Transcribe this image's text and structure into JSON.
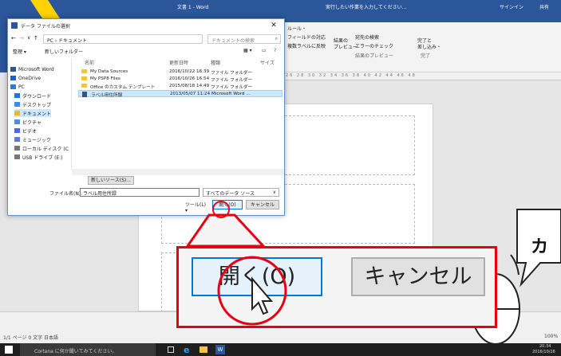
{
  "word": {
    "doc_title": "文書 1 - Word",
    "tell_me": "実行したい作業を入力してください...",
    "signin": "サインイン",
    "share": "共有",
    "ribbon_items": [
      "ルール・",
      "フィールドの対応",
      "複数ラベルに反映",
      "結果の",
      "プレビュー",
      "宛先の検索",
      "エラーのチェック",
      "結果のプレビュー",
      "完了と",
      "差し込み・",
      "完了"
    ],
    "ruler_numbers": "24 26 28 30 32 34 36 38 40 42 44 46 48",
    "status": "1/1 ページ  0 文字  日本語",
    "zoom": "100%"
  },
  "taskbar": {
    "cortana": "Cortana に何か聞いてみてください。",
    "time": "20:34",
    "date": "2016/10/26"
  },
  "dialog": {
    "title": "データ ファイルの選択",
    "breadcrumb": "PC › ドキュメント",
    "search_placeholder": "ドキュメントの検索",
    "organize": "整理 ▾",
    "new_folder": "新しいフォルダー",
    "nav": [
      "Microsoft Word",
      "OneDrive",
      "PC",
      "ダウンロード",
      "デスクトップ",
      "ドキュメント",
      "ピクチャ",
      "ビデオ",
      "ミュージック",
      "ローカル ディスク (C",
      "USB ドライブ (E:)"
    ],
    "columns": [
      "名前",
      "更新日時",
      "種類",
      "サイズ"
    ],
    "files": [
      {
        "name": "My Data Sources",
        "date": "2016/10/22 16:39",
        "type": "ファイル フォルダー"
      },
      {
        "name": "My PSP8 Files",
        "date": "2016/10/26 16:54",
        "type": "ファイル フォルダー"
      },
      {
        "name": "Office のカスタム テンプレート",
        "date": "2015/08/18 14:49",
        "type": "ファイル フォルダー"
      },
      {
        "name": "ラベル用住所録",
        "date": "2013/05/07 11:24",
        "type": "Microsoft Word ..."
      }
    ],
    "new_source": "新しいソース(S)...",
    "filename_label": "ファイル名(N):",
    "filename_value": "ラベル用住所録",
    "filetype": "すべてのデータ ソース",
    "tools": "ツール(L)  ▾",
    "open": "開く(O)",
    "cancel": "キャンセル"
  },
  "zoom": {
    "open": "開く(O)",
    "cancel": "キャンセル"
  },
  "bubble": {
    "text": "カ"
  },
  "colors": {
    "word_blue": "#2b579a",
    "highlight_red": "#e60012",
    "swoosh_yellow": "#ffd200"
  }
}
